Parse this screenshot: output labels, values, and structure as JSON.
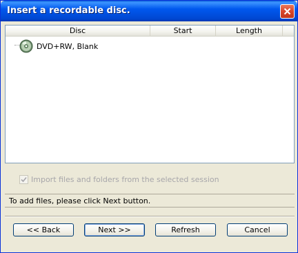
{
  "window": {
    "title": "Insert a recordable disc."
  },
  "listview": {
    "columns": [
      "Disc",
      "Start",
      "Length"
    ],
    "items": [
      {
        "label": "DVD+RW, Blank",
        "icon": "disc-icon"
      }
    ]
  },
  "import_checkbox": {
    "label": "Import files and folders from the selected session",
    "checked": true,
    "enabled": false
  },
  "status": {
    "text": "To add files, please click Next button."
  },
  "buttons": {
    "back": "<< Back",
    "next": "Next >>",
    "refresh": "Refresh",
    "cancel": "Cancel"
  },
  "colors": {
    "titlebar": "#0058ee",
    "close": "#d8452a",
    "face": "#ece9d8"
  }
}
